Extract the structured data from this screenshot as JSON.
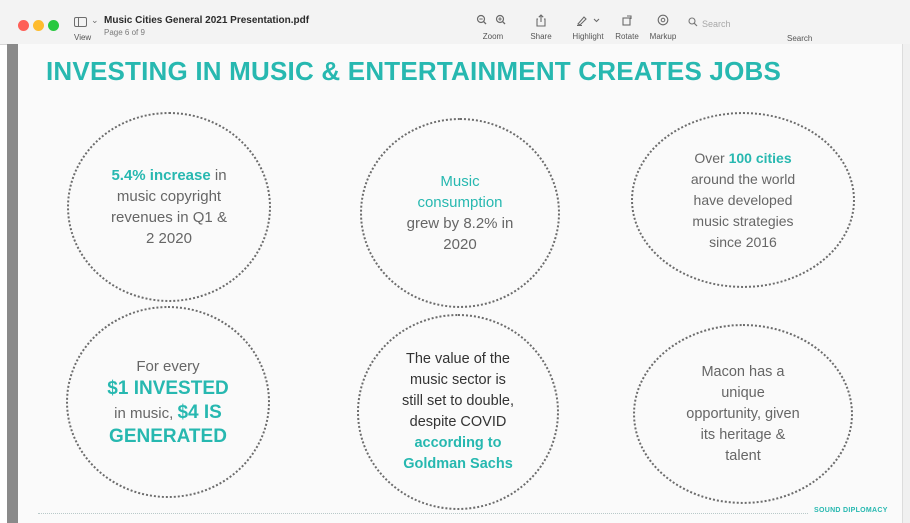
{
  "window": {
    "title": "Music Cities General 2021 Presentation.pdf",
    "subtitle": "Page 6 of 9",
    "view_label": "View"
  },
  "toolbar": {
    "zoom_label": "Zoom",
    "share_label": "Share",
    "highlight_label": "Highlight",
    "rotate_label": "Rotate",
    "markup_label": "Markup",
    "search_placeholder": "Search",
    "search_label": "Search"
  },
  "slide": {
    "heading": "INVESTING IN MUSIC & ENTERTAINMENT CREATES JOBS",
    "cards": {
      "c1": {
        "highlight": "5.4% increase",
        "rest_1": " in",
        "line_2": "music copyright",
        "line_3": "revenues in Q1 &",
        "line_4": "2 2020"
      },
      "c2": {
        "line_1": "Music",
        "line_2": "consumption",
        "line_3": "grew by 8.2% in",
        "line_4": "2020"
      },
      "c3": {
        "prefix": "Over ",
        "highlight": "100 cities",
        "line_2": "around the world",
        "line_3": "have developed",
        "line_4": "music strategies",
        "line_5": "since 2016"
      },
      "c4": {
        "line_1": "For every",
        "line_2": "$1 INVESTED",
        "line_3a": "in  music, ",
        "line_3b": "$4 IS",
        "line_4": "GENERATED"
      },
      "c5": {
        "line_1": "The value of the",
        "line_2": "music sector is",
        "line_3": "still set to double,",
        "line_4": "despite COVID",
        "line_5": "according to",
        "line_6": "Goldman Sachs"
      },
      "c6": {
        "line_1": "Macon has a",
        "line_2": "unique",
        "line_3": "opportunity, given",
        "line_4": "its heritage &",
        "line_5": "talent"
      }
    },
    "footer": "SOUND DIPLOMACY"
  }
}
